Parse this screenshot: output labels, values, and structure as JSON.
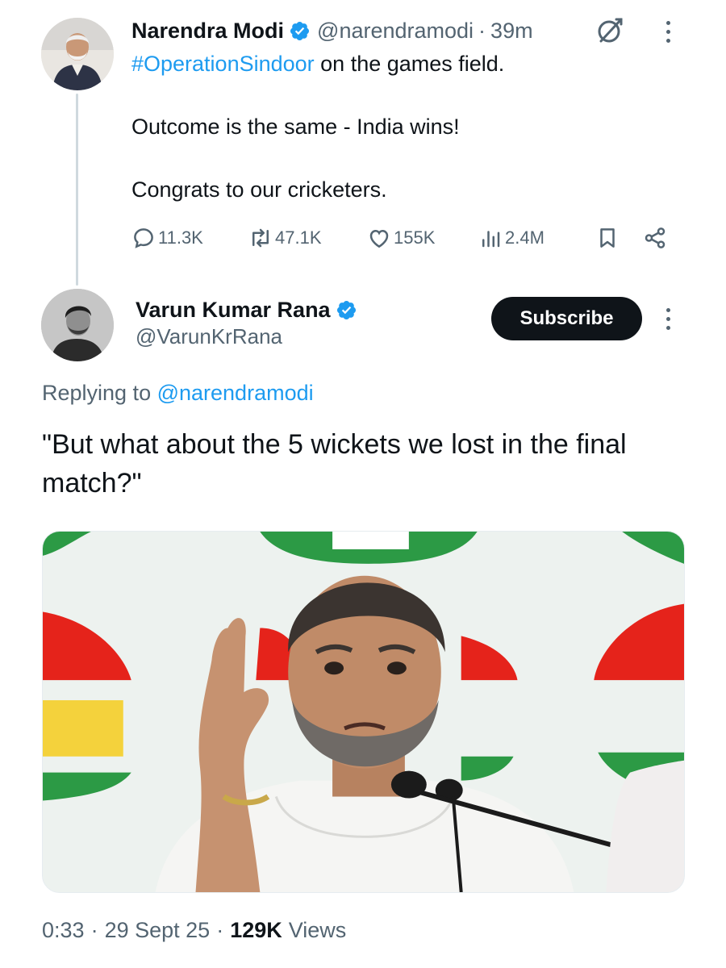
{
  "parent_tweet": {
    "author_name": "Narendra Modi",
    "handle": "@narendramodi",
    "separator": "·",
    "time": "39m",
    "hashtag": "#OperationSindoor",
    "line1_rest": " on the games field.",
    "line2": "Outcome is the same - India wins!",
    "line3": "Congrats to our cricketers.",
    "stats": {
      "replies": "11.3K",
      "reposts": "47.1K",
      "likes": "155K",
      "views": "2.4M"
    }
  },
  "reply_tweet": {
    "author_name": "Varun Kumar Rana",
    "handle": "@VarunKrRana",
    "subscribe_label": "Subscribe",
    "replying_prefix": "Replying to ",
    "replying_to": "@narendramodi",
    "text": "\"But what about the 5 wickets we lost in the final match?\"",
    "meta": {
      "timestamp": "0:33",
      "date": "29 Sept 25",
      "views_count": "129K",
      "views_label": "Views",
      "separator": "·"
    }
  },
  "icons": {
    "verified": "verified-badge-icon",
    "grok": "grok-icon",
    "more": "more-vertical-icon",
    "reply": "reply-icon",
    "repost": "repost-icon",
    "like": "heart-icon",
    "views": "analytics-icon",
    "bookmark": "bookmark-icon",
    "share": "share-icon"
  },
  "colors": {
    "text_primary": "#0f1419",
    "text_secondary": "#536471",
    "link": "#1d9bf0",
    "verified": "#1d9bf0",
    "button_bg": "#0f1419",
    "button_text": "#ffffff",
    "thread_line": "#cfd9de"
  }
}
